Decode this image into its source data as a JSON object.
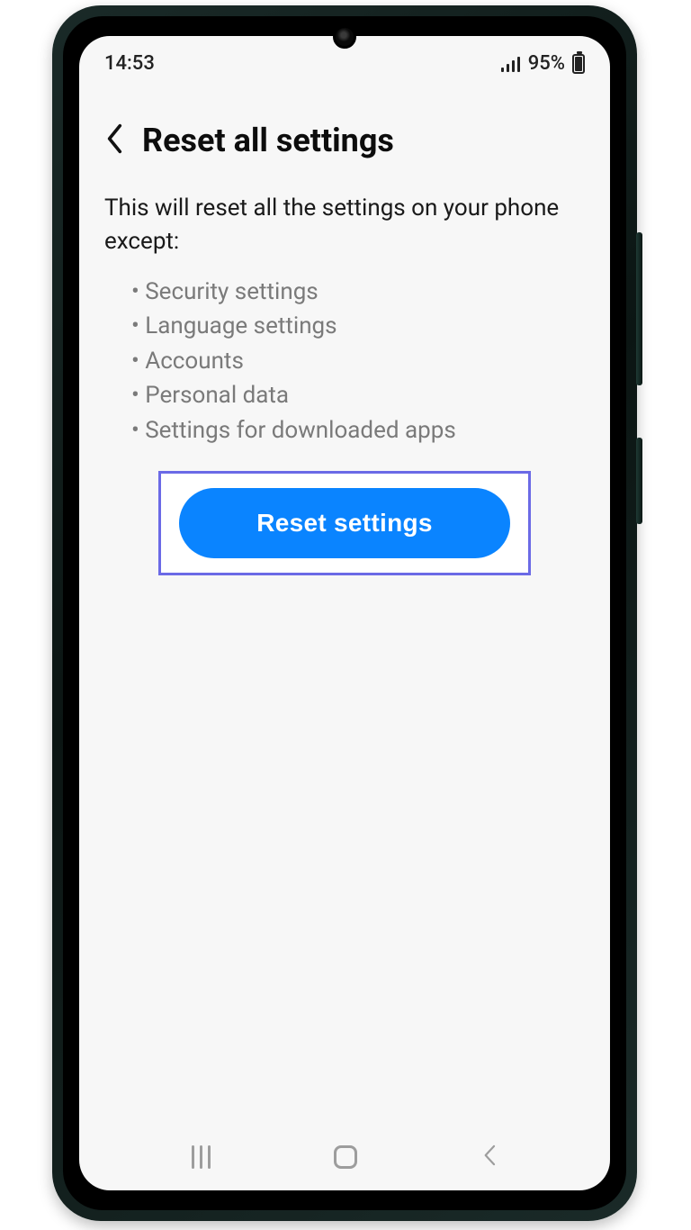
{
  "status": {
    "time": "14:53",
    "battery_pct": "95%"
  },
  "header": {
    "title": "Reset all settings"
  },
  "body": {
    "intro": "This will reset all the settings on your phone except:",
    "exceptions": [
      "Security settings",
      "Language settings",
      "Accounts",
      "Personal data",
      "Settings for downloaded apps"
    ]
  },
  "actions": {
    "reset_label": "Reset settings"
  },
  "colors": {
    "accent": "#0a84ff",
    "highlight_border": "#6b6ae6"
  }
}
